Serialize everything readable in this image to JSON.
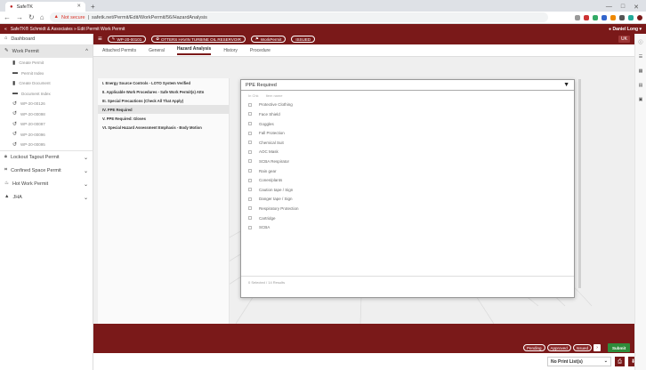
{
  "browser": {
    "tab_title": "SafeTK",
    "new_tab": "+",
    "security_warning": "Not secure",
    "url": "safetk.net/Permit/Edit/WorkPermit/56/HazardAnalysis",
    "win_min": "—",
    "win_max": "□",
    "win_close": "✕"
  },
  "app_header": {
    "collapse": "«",
    "breadcrumb": "SafeTK® Schmidt & Associates » Edit Permit Work Permit",
    "user": "Daniel Long"
  },
  "sidebar": {
    "dashboard": "Dashboard",
    "work_permit": "Work Permit",
    "sub_items": [
      "Create Permit",
      "Permit Index",
      "Create Document",
      "Document Index",
      "WP-20-00126",
      "WP-20-00098",
      "WP-20-00097",
      "WP-20-00096",
      "WP-20-00095"
    ],
    "groups": [
      "Lockout Tagout Permit",
      "Confined Space Permit",
      "Hot Work Permit",
      "JHA"
    ]
  },
  "toolbar": {
    "permit_id": "WP-20-00101",
    "site": "OTTERS HAVIN TURBINE OIL RESERVOIR",
    "permit_type": "WorkPermit",
    "status": "ISSUED",
    "right_label": "UK"
  },
  "tabs": [
    "Attached Permits",
    "General",
    "Hazard Analysis",
    "History",
    "Procedure"
  ],
  "active_tab": "Hazard Analysis",
  "sections": [
    "I. Energy Source Controls - LOTO System Verified",
    "II. Applicable Work Procedures - Safe Work Permit(s) Attn",
    "III. Special Precautions (Check All That Apply)",
    "IV. PPE Required",
    "V. PPE Required: Gloves",
    "VI. Special Hazard Assessment Emphasis - Body Motion"
  ],
  "selected_section": "IV. PPE Required",
  "dropdown": {
    "title": "PPE Required",
    "col_check": "In Chk",
    "col_item": "Item name",
    "items": [
      "Protective Clothing",
      "Face Shield",
      "Goggles",
      "Fall Protection",
      "Chemical Suit",
      "AOC Mask",
      "SCBA Respirator",
      "Rain gear",
      "Cones/plants",
      "Caution tape / Sign",
      "Danger tape / Sign",
      "Respiratory Protection",
      "Cartridge",
      "SCBA"
    ],
    "footer": "0 Selected / 14 Results"
  },
  "actions": {
    "pill1": "Pending",
    "pill2": "Approved",
    "pill3": "Issued",
    "next": "›",
    "submit": "Submit"
  },
  "print": {
    "select": "No Print List(s)",
    "printer_icon": "printer-icon",
    "download_icon": "download-icon"
  }
}
